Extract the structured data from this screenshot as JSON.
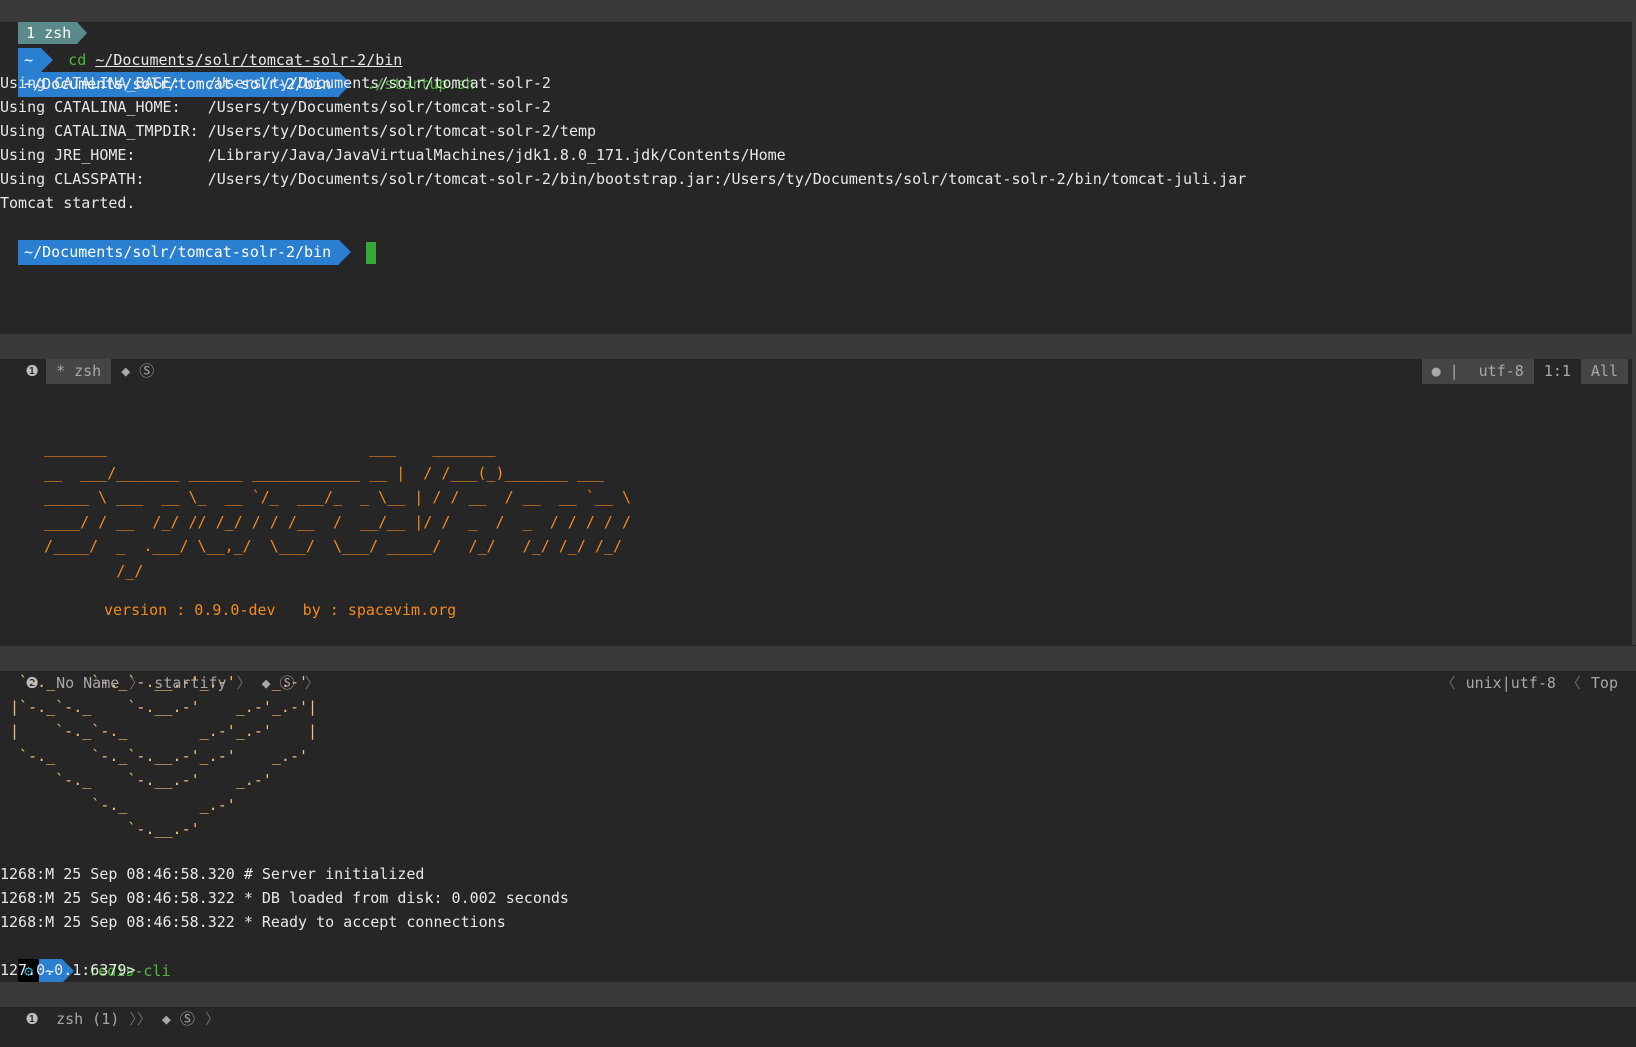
{
  "tmux_tab": {
    "label": "1 zsh"
  },
  "pane1": {
    "cmd_prompt_dir": "~",
    "cmd_text": "cd",
    "cmd_arg": "~/Documents/solr/tomcat-solr-2/bin",
    "prompt_dir": "~/Documents/solr/tomcat-solr-2/bin",
    "startup_cmd": "./startup.sh",
    "output": [
      "Using CATALINA_BASE:   /Users/ty/Documents/solr/tomcat-solr-2",
      "Using CATALINA_HOME:   /Users/ty/Documents/solr/tomcat-solr-2",
      "Using CATALINA_TMPDIR: /Users/ty/Documents/solr/tomcat-solr-2/temp",
      "Using JRE_HOME:        /Library/Java/JavaVirtualMachines/jdk1.8.0_171.jdk/Contents/Home",
      "Using CLASSPATH:       /Users/ty/Documents/solr/tomcat-solr-2/bin/bootstrap.jar:/Users/ty/Documents/solr/tomcat-solr-2/bin/tomcat-juli.jar",
      "Tomcat started."
    ],
    "prompt_dir_2": "~/Documents/solr/tomcat-solr-2/bin"
  },
  "status1": {
    "num": "❶",
    "name": "* zsh",
    "icons": "◆ Ⓢ",
    "right_os": "",
    "right_enc": "utf-8",
    "right_pos": "1:1",
    "right_scroll": "All"
  },
  "pane2": {
    "ascii_logo": "_______                             ___    _______\n__  ___/_______ ______ ____________ __ |  / /___(_)_______ ___\n_____ \\ ___  __ \\_  __ `/_  ___/_  _ \\__ | / / __  / __  __ `__ \\\n____/ / __  /_/ // /_/ / / /__  /  __/__ |/ /  _  /  _  / / / / /\n/____/  _  .___/ \\__,_/  \\___/  \\___/ _____/   /_/   /_/ /_/ /_/\n        /_/",
    "version": "version : 0.9.0-dev   by : spacevim.org"
  },
  "status2": {
    "num": "❷",
    "name": "No Name",
    "ft": "startify",
    "icons": "◆ Ⓢ",
    "right_enc": "unix|utf-8",
    "right_scroll": "Top"
  },
  "pane3": {
    "ascii_redis": " `-._    `-._`-.__.-'_.-'    _.-'\n|`-._`-._    `-.__.-'    _.-'_.-'|\n|    `-._`-._        _.-'_.-'    |\n `-._    `-._`-.__.-'_.-'    _.-'\n     `-._    `-.__.-'    _.-'\n         `-._        _.-'\n             `-.__.-'",
    "log": [
      "1268:M 25 Sep 08:46:58.320 # Server initialized",
      "1268:M 25 Sep 08:46:58.322 * DB loaded from disk: 0.002 seconds",
      "1268:M 25 Sep 08:46:58.322 * Ready to accept connections"
    ],
    "gear": "⚙",
    "prompt_dir": "~",
    "cmd": "redis-cli",
    "redis_prompt": "127.0.0.1:6379>"
  },
  "status3": {
    "num": "❶",
    "name": "zsh (1)",
    "icons": "◆ Ⓢ"
  }
}
